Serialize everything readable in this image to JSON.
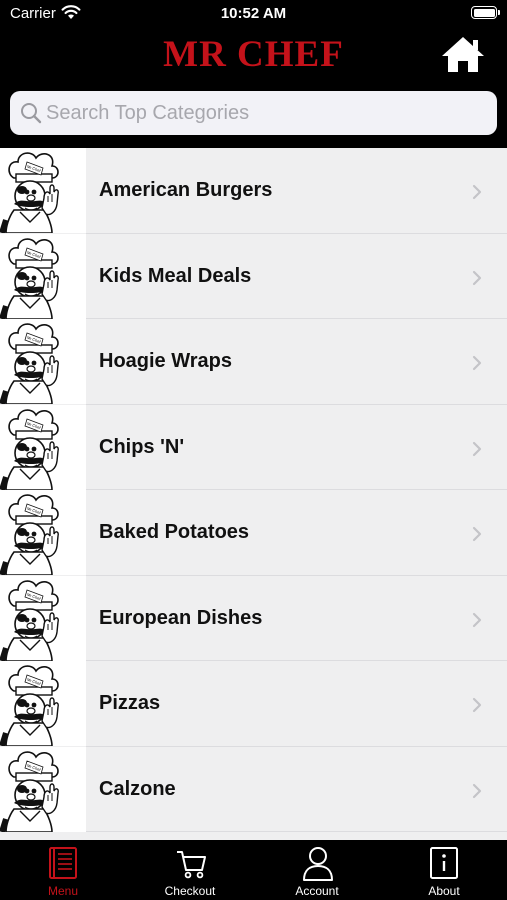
{
  "status": {
    "carrier": "Carrier",
    "time": "10:52 AM"
  },
  "header": {
    "brand": "MR CHEF",
    "home_icon": "home-icon"
  },
  "search": {
    "placeholder": "Search Top Categories",
    "value": ""
  },
  "categories": [
    {
      "label": "American Burgers"
    },
    {
      "label": "Kids Meal Deals"
    },
    {
      "label": "Hoagie Wraps"
    },
    {
      "label": "Chips 'N'"
    },
    {
      "label": "Baked Potatoes"
    },
    {
      "label": "European Dishes"
    },
    {
      "label": "Pizzas"
    },
    {
      "label": "Calzone"
    }
  ],
  "tabs": [
    {
      "label": "Menu",
      "icon": "menu-book-icon",
      "active": true
    },
    {
      "label": "Checkout",
      "icon": "cart-icon",
      "active": false
    },
    {
      "label": "Account",
      "icon": "person-icon",
      "active": false
    },
    {
      "label": "About",
      "icon": "info-icon",
      "active": false
    }
  ],
  "colors": {
    "brand_red": "#c4121a",
    "background": "#000000",
    "list_background": "#efeff0"
  }
}
